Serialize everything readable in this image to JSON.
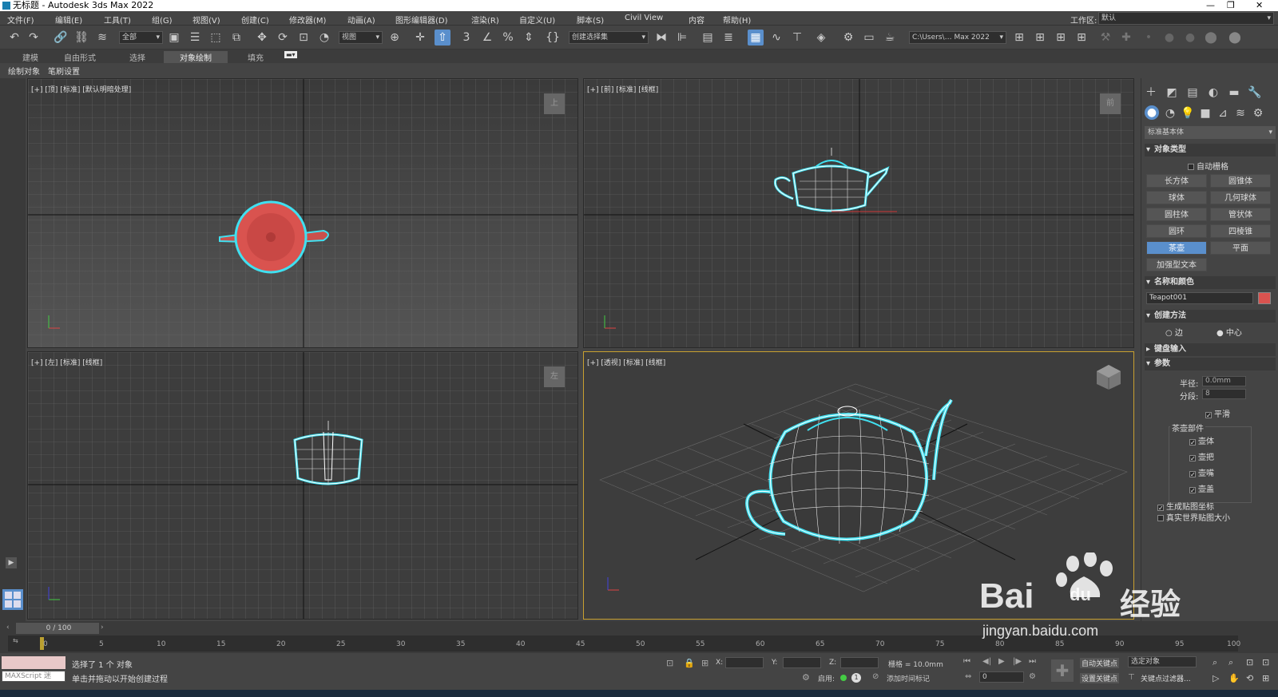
{
  "window": {
    "title": "无标题 - Autodesk 3ds Max 2022",
    "minimize": "—",
    "restore": "❐",
    "close": "✕"
  },
  "menu": [
    "文件(F)",
    "编辑(E)",
    "工具(T)",
    "组(G)",
    "视图(V)",
    "创建(C)",
    "修改器(M)",
    "动画(A)",
    "图形编辑器(D)",
    "渲染(R)",
    "自定义(U)",
    "脚本(S)",
    "Civil View",
    "内容",
    "帮助(H)"
  ],
  "workspace": {
    "label": "工作区:",
    "value": "默认"
  },
  "toolbar": {
    "filter_value": "全部",
    "refcoord_value": "视图",
    "selection_set_value": "创建选择集",
    "path_value": "C:\\Users\\… Max 2022",
    "snap_label": "3"
  },
  "ribbon": {
    "tabs": [
      "建模",
      "自由形式",
      "选择",
      "对象绘制",
      "填充"
    ],
    "active": "对象绘制"
  },
  "subribbon": [
    "绘制对象",
    "笔刷设置"
  ],
  "viewports": {
    "top": {
      "label": "[+] [顶] [标准] [默认明暗处理]",
      "cube": "上"
    },
    "front": {
      "label": "[+] [前] [标准] [线框]",
      "cube": "前"
    },
    "left": {
      "label": "[+] [左] [标准] [线框]",
      "cube": "左"
    },
    "persp": {
      "label": "[+] [透视] [标准] [线框]"
    }
  },
  "command_panel": {
    "dropdown": "标准基本体",
    "object_type": {
      "header": "对象类型",
      "autogrid": "自动栅格",
      "buttons": [
        "长方体",
        "圆锥体",
        "球体",
        "几何球体",
        "圆柱体",
        "管状体",
        "圆环",
        "四棱锥",
        "茶壶",
        "平面",
        "加强型文本"
      ],
      "active": "茶壶"
    },
    "name_color": {
      "header": "名称和颜色",
      "name": "Teapot001",
      "color": "#d9534f"
    },
    "creation_method": {
      "header": "创建方法",
      "edge": "边",
      "center": "中心"
    },
    "keyboard_entry": {
      "header": "键盘输入"
    },
    "params": {
      "header": "参数",
      "radius_label": "半径:",
      "radius": "0.0mm",
      "segments_label": "分段:",
      "segments": "8",
      "smooth": "平滑",
      "parts_header": "茶壶部件",
      "parts": [
        "壶体",
        "壶把",
        "壶嘴",
        "壶盖"
      ],
      "gen_map": "生成贴图坐标",
      "real_world": "真实世界贴图大小"
    }
  },
  "timeline": {
    "frame": "0 / 100",
    "ticks": [
      "5",
      "10",
      "15",
      "20",
      "25",
      "30",
      "35",
      "40",
      "45",
      "50",
      "55",
      "60",
      "65",
      "70",
      "75",
      "80",
      "85",
      "90",
      "95",
      "100"
    ],
    "start": "0"
  },
  "status": {
    "maxscript": "MAXScript 迷",
    "selected": "选择了 1 个 对象",
    "prompt": "单击并拖动以开始创建过程",
    "x_label": "X:",
    "y_label": "Y:",
    "z_label": "Z:",
    "grid": "栅格 = 10.0mm",
    "enable": "启用:",
    "add_time_tag": "添加时间标记",
    "auto_key": "自动关键点",
    "selected_obj": "选定对象",
    "set_key": "设置关键点",
    "key_filters": "关键点过滤器...",
    "frame_field": "0"
  },
  "watermark": {
    "brand": "Bai",
    "du": "du",
    "cn": "经验",
    "url": "jingyan.baidu.com"
  },
  "colors": {
    "teapot": "#d9534f",
    "select": "#40e0f0",
    "accent": "#5a8fcc",
    "active_vp": "#c8a030"
  }
}
